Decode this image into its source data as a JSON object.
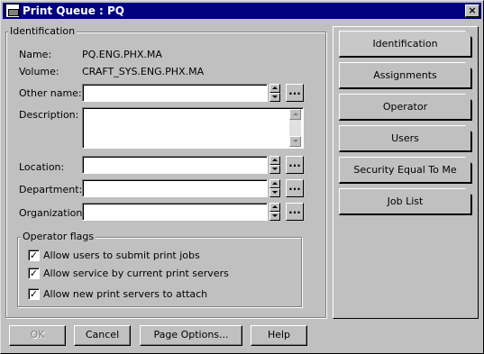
{
  "window": {
    "title": "Print Queue : PQ",
    "close_glyph": "×"
  },
  "identification": {
    "group_label": "Identification",
    "name_label": "Name:",
    "name_value": "PQ.ENG.PHX.MA",
    "volume_label": "Volume:",
    "volume_value": "CRAFT_SYS.ENG.PHX.MA",
    "other_name_label": "Other name:",
    "other_name_value": "",
    "description_label": "Description:",
    "description_value": "",
    "location_label": "Location:",
    "location_value": "",
    "department_label": "Department:",
    "department_value": "",
    "organization_label": "Organization:",
    "organization_value": "",
    "browse_glyph": "..."
  },
  "operator_flags": {
    "group_label": "Operator flags",
    "items": [
      {
        "label": "Allow users to submit print jobs",
        "checked": true
      },
      {
        "label": "Allow service by current print servers",
        "checked": true
      },
      {
        "label": "Allow new print servers to attach",
        "checked": true
      }
    ],
    "check_glyph": "✓"
  },
  "pages": [
    {
      "label": "Identification",
      "active": true
    },
    {
      "label": "Assignments",
      "active": false
    },
    {
      "label": "Operator",
      "active": false
    },
    {
      "label": "Users",
      "active": false
    },
    {
      "label": "Security Equal To Me",
      "active": false
    },
    {
      "label": "Job List",
      "active": false
    }
  ],
  "buttons": {
    "ok": "OK",
    "cancel": "Cancel",
    "page_options": "Page Options...",
    "help": "Help"
  }
}
